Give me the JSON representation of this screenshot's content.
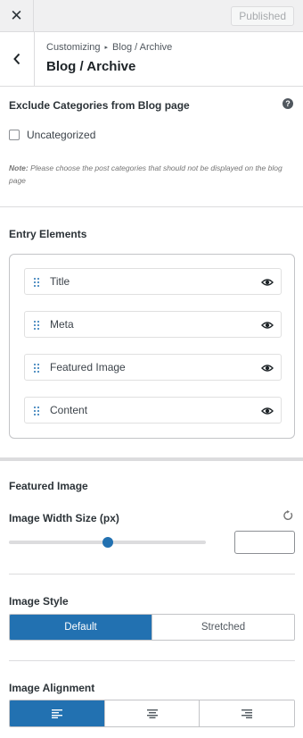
{
  "topbar": {
    "close_glyph": "✕",
    "published_label": "Published"
  },
  "header": {
    "breadcrumb_root": "Customizing",
    "breadcrumb_sep": "▸",
    "breadcrumb_current": "Blog / Archive",
    "title": "Blog / Archive"
  },
  "exclude": {
    "title": "Exclude Categories from Blog page",
    "help_glyph": "?",
    "checkbox_label": "Uncategorized",
    "checkbox_checked": false,
    "note_prefix": "Note:",
    "note_text": "Please choose the post categories that should not be displayed on the blog page"
  },
  "entry": {
    "title": "Entry Elements",
    "items": [
      {
        "label": "Title",
        "icon": "eye-icon"
      },
      {
        "label": "Meta",
        "icon": "eye-icon"
      },
      {
        "label": "Featured Image",
        "icon": "eye-icon"
      },
      {
        "label": "Content",
        "icon": "eye-icon"
      }
    ]
  },
  "featured": {
    "title": "Featured Image",
    "width_label": "Image Width Size (px)",
    "width_value": "",
    "slider_fraction": 0.5,
    "reset_icon": "reset-icon",
    "style_label": "Image Style",
    "style_options": [
      "Default",
      "Stretched"
    ],
    "style_selected": "Default",
    "alignment_label": "Image Alignment",
    "alignment_options": [
      "align-left-icon",
      "align-center-icon",
      "align-right-icon"
    ],
    "alignment_selected": "align-left-icon"
  },
  "colors": {
    "accent": "#2271b1",
    "panel_bg": "#ffffff",
    "chrome_bg": "#f0f0f1"
  }
}
